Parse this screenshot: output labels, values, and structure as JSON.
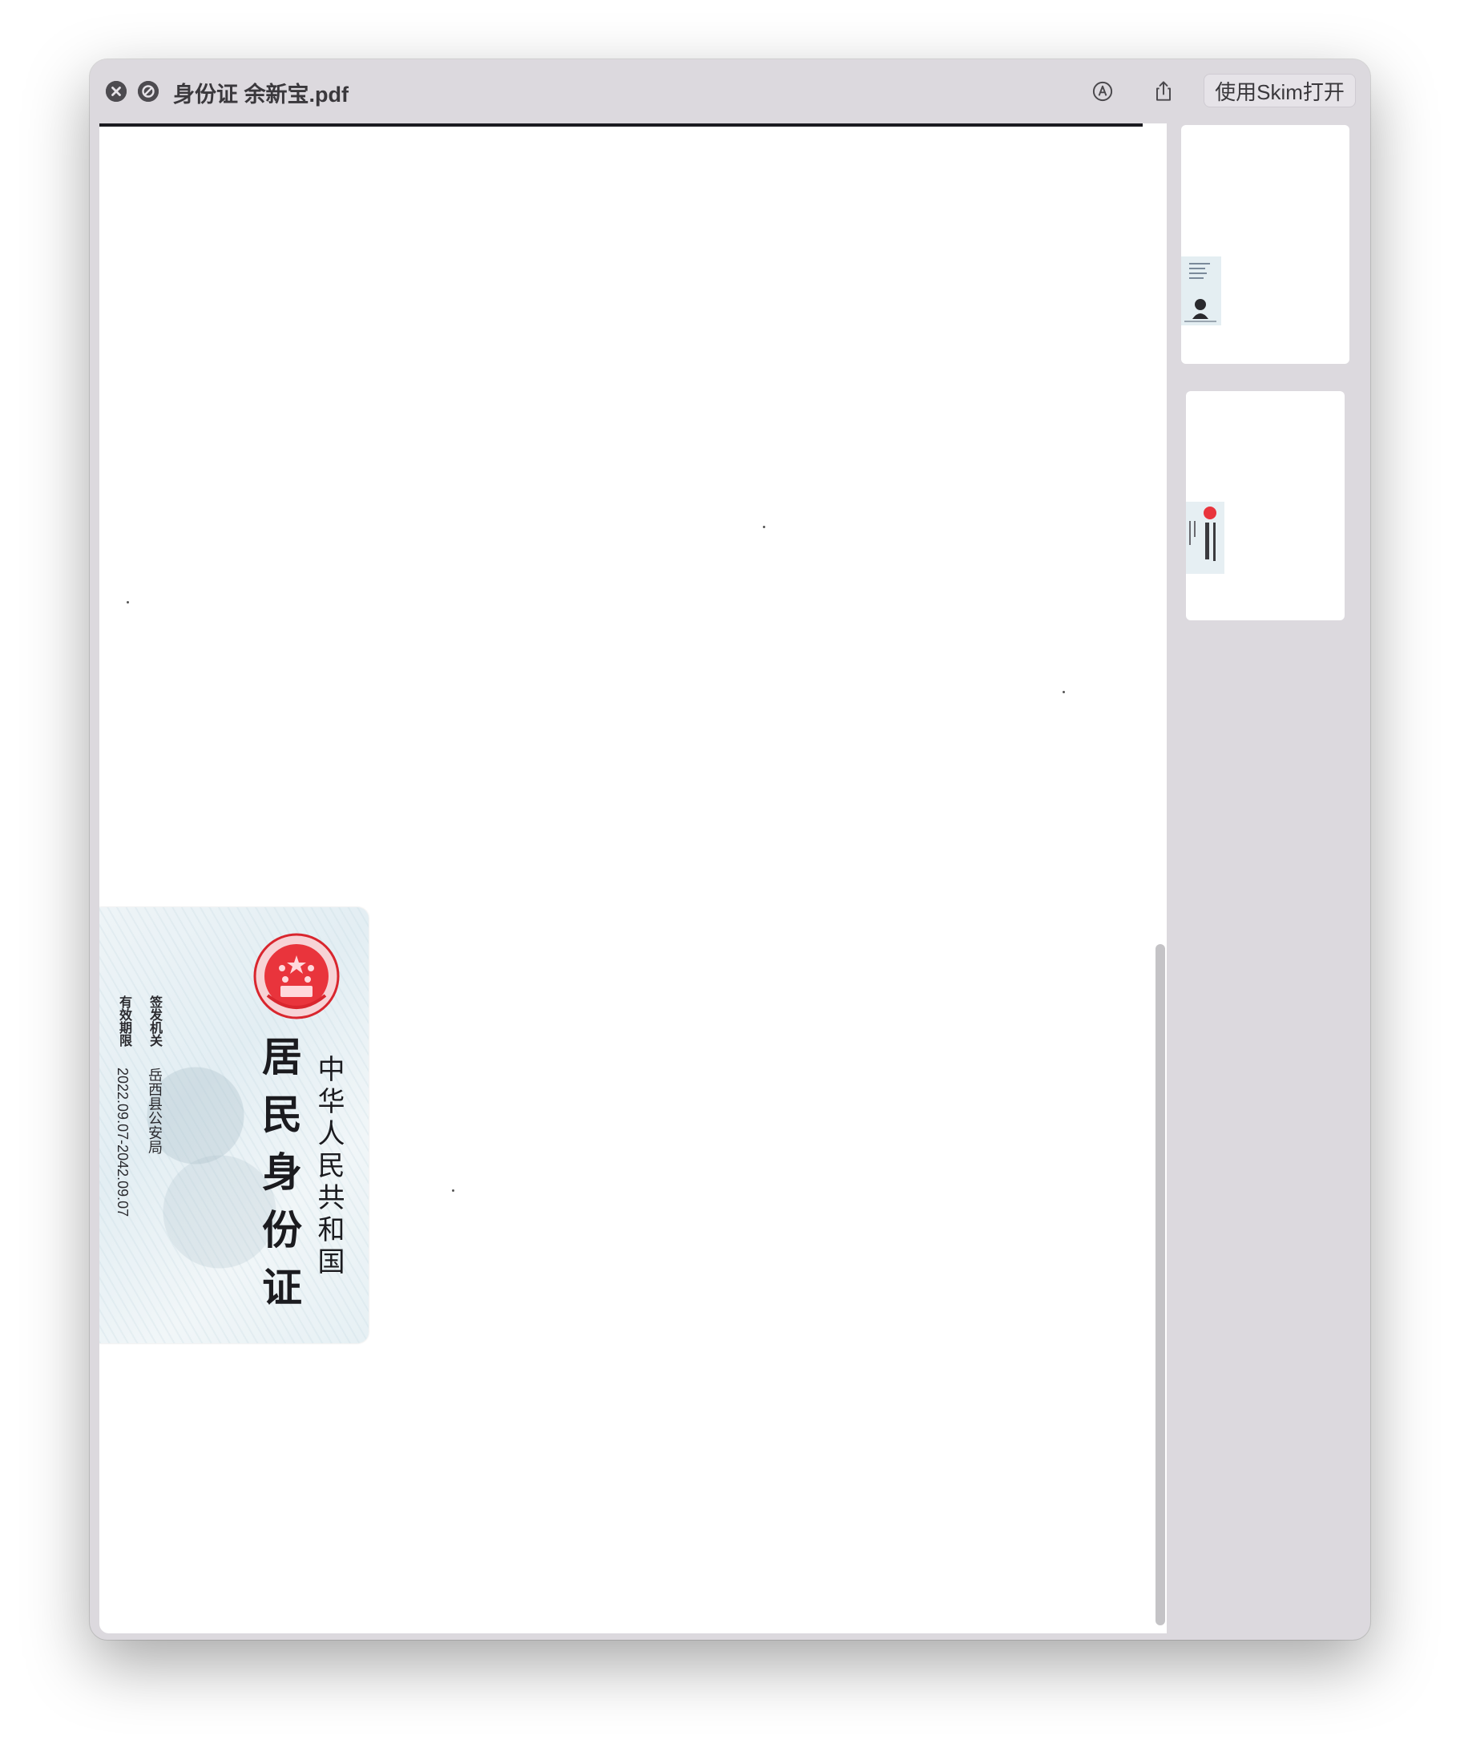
{
  "window": {
    "title": "身份证 余新宝.pdf",
    "open_button_label": "使用Skim打开"
  },
  "toolbar": {
    "close_icon": "close-icon",
    "pin_icon": "slash-circle-icon",
    "markup_icon": "markup-pen-icon",
    "share_icon": "share-icon"
  },
  "id_card": {
    "country": "中华人民共和国",
    "card_title": "居民身份证",
    "issuer_label": "签发机关",
    "issuer_value": "岳西县公安局",
    "validity_label": "有效期限",
    "validity_value": "2022.09.07-2042.09.07",
    "emblem_color": "#d9262e"
  },
  "thumbnails": {
    "count": 2,
    "pages": [
      {
        "page": 1,
        "content": "id-card-front"
      },
      {
        "page": 2,
        "content": "id-card-back"
      }
    ]
  },
  "colors": {
    "window_bg": "#dcd9de",
    "title_text": "#3a383c",
    "page_bg": "#ffffff"
  }
}
